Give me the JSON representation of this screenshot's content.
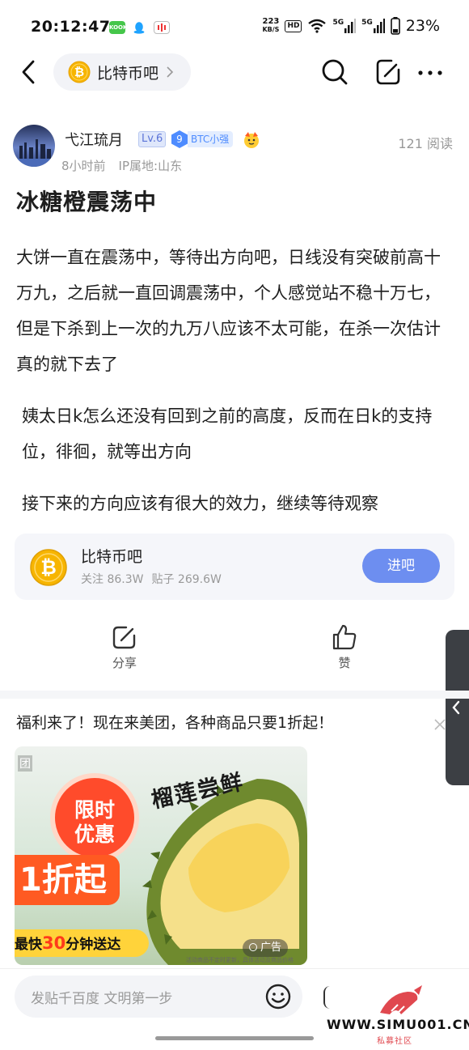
{
  "status_bar": {
    "time": "20:12:47",
    "speed_value": "223",
    "speed_unit": "KB/S",
    "hd_label": "HD",
    "net1": "5G",
    "net2": "5G",
    "battery": "23%",
    "kook_label": "KOOK"
  },
  "nav": {
    "forum_name": "比特币吧"
  },
  "post": {
    "author": "弋江琉月",
    "level": "Lv.6",
    "badge_num": "9",
    "badge_text": "BTC小强",
    "time_ago": "8小时前",
    "ip_location": "IP属地:山东",
    "read_count": "121 阅读",
    "title": "冰糖橙震荡中",
    "paragraphs": [
      "大饼一直在震荡中，等待出方向吧，日线没有突破前高十万九，之后就一直回调震荡中，个人感觉站不稳十万七，但是下杀到上一次的九万八应该不太可能，在杀一次估计真的就下去了",
      " 姨太日k怎么还没有回到之前的高度，反而在日k的支持位，徘徊，就等出方向",
      " 接下来的方向应该有很大的效力，继续等待观察"
    ]
  },
  "forum_card": {
    "name": "比特币吧",
    "followers": "关注 86.3W",
    "posts": "贴子 269.6W",
    "enter_label": "进吧"
  },
  "actions": {
    "share_label": "分享",
    "like_label": "赞"
  },
  "ad": {
    "text": "福利来了！现在来美团，各种商品只要1折起！",
    "brand": "团",
    "promo_title": "榴莲尝鲜",
    "limit_line1": "限时",
    "limit_line2": "优惠",
    "zhe": "1折起",
    "strip_prefix": "最快",
    "strip_num": "30",
    "strip_suffix": "分钟送达",
    "tag": "广告",
    "small_print": "活动商品不定时更新，具体活动及商品价格"
  },
  "bottom": {
    "reply_placeholder": "发贴千百度 文明第一步",
    "watermark_url": "WWW.SIMU001.CN",
    "watermark_sub": "私募社区"
  },
  "colors": {
    "accent": "#6d8ef0",
    "level_badge": "#5b74d8",
    "btc_badge": "#4e8cff",
    "coin": "#f7b500",
    "ad_orange": "#ff5a22",
    "watermark_red": "#e0484f"
  }
}
